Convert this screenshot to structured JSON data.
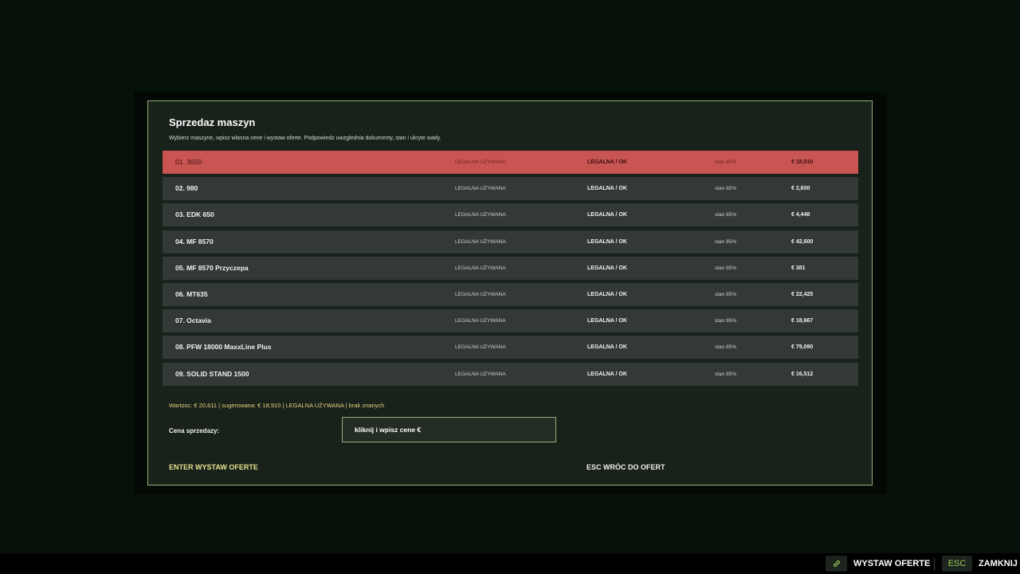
{
  "dialog": {
    "title": "Sprzedaz maszyn",
    "subtitle": "Wybierz maszyne, wpisz wlasna cene i wystaw oferte. Podpowiedz uwzglednia dokumenty, stan i ukryte wady."
  },
  "machines": [
    {
      "name": "01. 3650",
      "legal": "LEGALNA UŻYWANA",
      "status": "LEGALNA / OK",
      "condition": "stan 85%",
      "price": "€ 18,910",
      "selected": true
    },
    {
      "name": "02. 980",
      "legal": "LEGALNA UŻYWANA",
      "status": "LEGALNA / OK",
      "condition": "stan 85%",
      "price": "€ 2,600",
      "selected": false
    },
    {
      "name": "03. EDK 650",
      "legal": "LEGALNA UŻYWANA",
      "status": "LEGALNA / OK",
      "condition": "stan 85%",
      "price": "€ 4,448",
      "selected": false
    },
    {
      "name": "04. MF 8570",
      "legal": "LEGALNA UŻYWANA",
      "status": "LEGALNA / OK",
      "condition": "stan 85%",
      "price": "€ 42,600",
      "selected": false
    },
    {
      "name": "05. MF 8570 Przyczepa",
      "legal": "LEGALNA UŻYWANA",
      "status": "LEGALNA / OK",
      "condition": "stan 85%",
      "price": "€ 381",
      "selected": false
    },
    {
      "name": "06. MT635",
      "legal": "LEGALNA UŻYWANA",
      "status": "LEGALNA / OK",
      "condition": "stan 85%",
      "price": "€ 22,425",
      "selected": false
    },
    {
      "name": "07. Octavia",
      "legal": "LEGALNA UŻYWANA",
      "status": "LEGALNA / OK",
      "condition": "stan 85%",
      "price": "€ 18,667",
      "selected": false
    },
    {
      "name": "08. PFW 18000 MaxxLine Plus",
      "legal": "LEGALNA UŻYWANA",
      "status": "LEGALNA / OK",
      "condition": "stan 85%",
      "price": "€ 79,090",
      "selected": false
    },
    {
      "name": "09. SOLID STAND 1500",
      "legal": "LEGALNA UŻYWANA",
      "status": "LEGALNA / OK",
      "condition": "stan 85%",
      "price": "€ 16,512",
      "selected": false
    }
  ],
  "info": "Wartosc: € 20,611 | sugerowana: € 18,910 | LEGALNA UŻYWANA | brak znanych",
  "price_field": {
    "label": "Cena sprzedazy:",
    "value": "kliknij i wpisz cene €"
  },
  "actions": {
    "enter_label": "ENTER WYSTAW OFERTE",
    "esc_label": "ESC WRÓC DO OFERT"
  },
  "bottom_bar": {
    "hint1_icon": "link-icon",
    "hint1_label": "WYSTAW OFERTE",
    "hint2_key": "ESC",
    "hint2_label": "ZAMKNIJ"
  },
  "colors": {
    "selected_row": "#c85552",
    "accent_border": "#8fb37a",
    "info_text": "#e9d27e",
    "enter_text": "#e7e590",
    "esc_key": "#9bc95b"
  }
}
